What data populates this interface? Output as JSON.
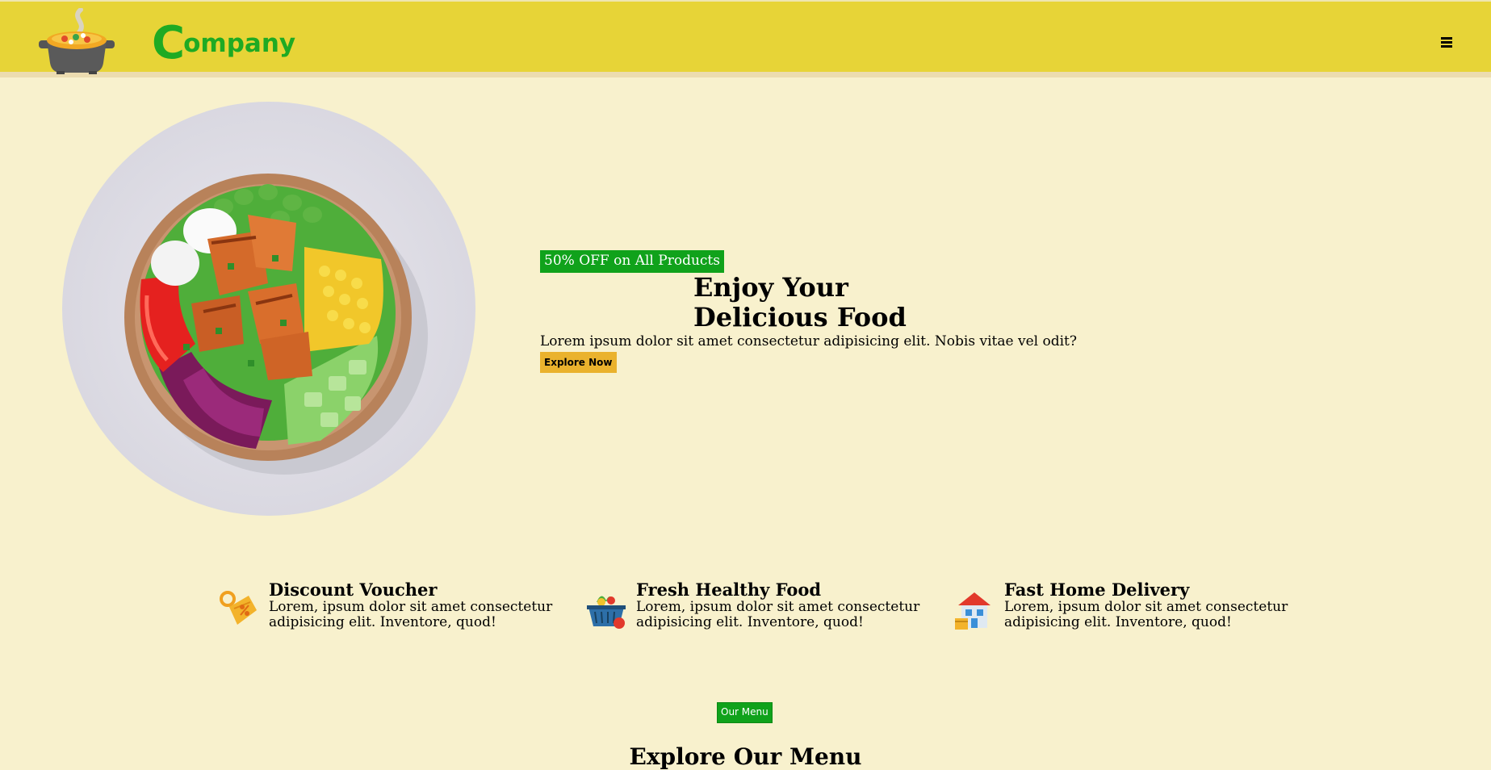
{
  "header": {
    "brand_first_letter": "C",
    "brand_rest": "ompany",
    "menu_icon": "hamburger-menu-icon"
  },
  "hero": {
    "badge": "50% OFF on All Products",
    "title": "Enjoy Your Delicious Food",
    "description": "Lorem ipsum dolor sit amet consectetur adipisicing elit. Nobis vitae vel odit?",
    "button": "Explore Now"
  },
  "features": [
    {
      "icon": "discount-voucher-icon",
      "title": "Discount Voucher",
      "description": "Lorem, ipsum dolor sit amet consectetur adipisicing elit. Inventore, quod!"
    },
    {
      "icon": "grocery-basket-icon",
      "title": "Fresh Healthy Food",
      "description": "Lorem, ipsum dolor sit amet consectetur adipisicing elit. Inventore, quod!"
    },
    {
      "icon": "home-delivery-icon",
      "title": "Fast Home Delivery",
      "description": "Lorem, ipsum dolor sit amet consectetur adipisicing elit. Inventore, quod!"
    }
  ],
  "menu_section": {
    "badge": "Our Menu",
    "title": "Explore Our Menu"
  },
  "colors": {
    "header_bg": "#e7d437",
    "page_bg": "#f8f1cd",
    "brand_green": "#1faa23",
    "badge_green": "#10a21b",
    "button_orange": "#eab22d"
  }
}
